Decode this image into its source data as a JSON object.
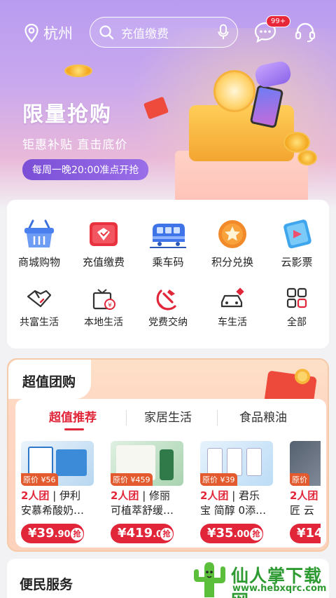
{
  "header": {
    "city": "杭州",
    "search_placeholder": "充值缴费",
    "message_badge": "99+"
  },
  "promo": {
    "title": "限量抢购",
    "subtitle": "钜惠补贴 直击底价",
    "schedule": "每周一晚20:00准点开抢"
  },
  "services": {
    "row1": [
      {
        "label": "商城购物",
        "icon": "shopping-basket-icon"
      },
      {
        "label": "充值缴费",
        "icon": "recharge-icon"
      },
      {
        "label": "乘车码",
        "icon": "train-icon"
      },
      {
        "label": "积分兑换",
        "icon": "points-star-icon"
      },
      {
        "label": "云影票",
        "icon": "movie-ticket-icon"
      }
    ],
    "row2": [
      {
        "label": "共富生活",
        "icon": "handshake-icon"
      },
      {
        "label": "本地生活",
        "icon": "local-shop-icon"
      },
      {
        "label": "党费交纳",
        "icon": "party-emblem-icon"
      },
      {
        "label": "车生活",
        "icon": "car-icon"
      },
      {
        "label": "全部",
        "icon": "grid-all-icon"
      }
    ]
  },
  "group_buy": {
    "title": "超值团购",
    "tabs": [
      "超值推荐",
      "家居生活",
      "食品粮油"
    ],
    "active_tab": 0,
    "products": [
      {
        "orig": "原价 ¥56",
        "tag": "2人团",
        "name1": "伊利",
        "name2": "安慕希酸奶…",
        "price_int": "¥39",
        "price_dec": ".90",
        "grab": "抢"
      },
      {
        "orig": "原价 ¥459",
        "tag": "2人团",
        "name1": "修丽",
        "name2": "可植萃舒缓…",
        "price_int": "¥419",
        "price_dec": ".00",
        "grab": "抢"
      },
      {
        "orig": "原价 ¥39",
        "tag": "2人团",
        "name1": "君乐",
        "name2": "宝 简醇 0添…",
        "price_int": "¥35",
        "price_dec": ".00",
        "grab": "抢"
      },
      {
        "orig": "原价",
        "tag": "2人团",
        "name1": "",
        "name2": "匠 云",
        "price_int": "¥14",
        "price_dec": "",
        "grab": ""
      }
    ]
  },
  "bianmin": {
    "title": "便民服务"
  },
  "watermark": {
    "text": "仙人掌下载网",
    "url": "www.hebxqrc.com"
  },
  "colors": {
    "accent": "#e1263a",
    "hero_top": "#b99cf0"
  }
}
